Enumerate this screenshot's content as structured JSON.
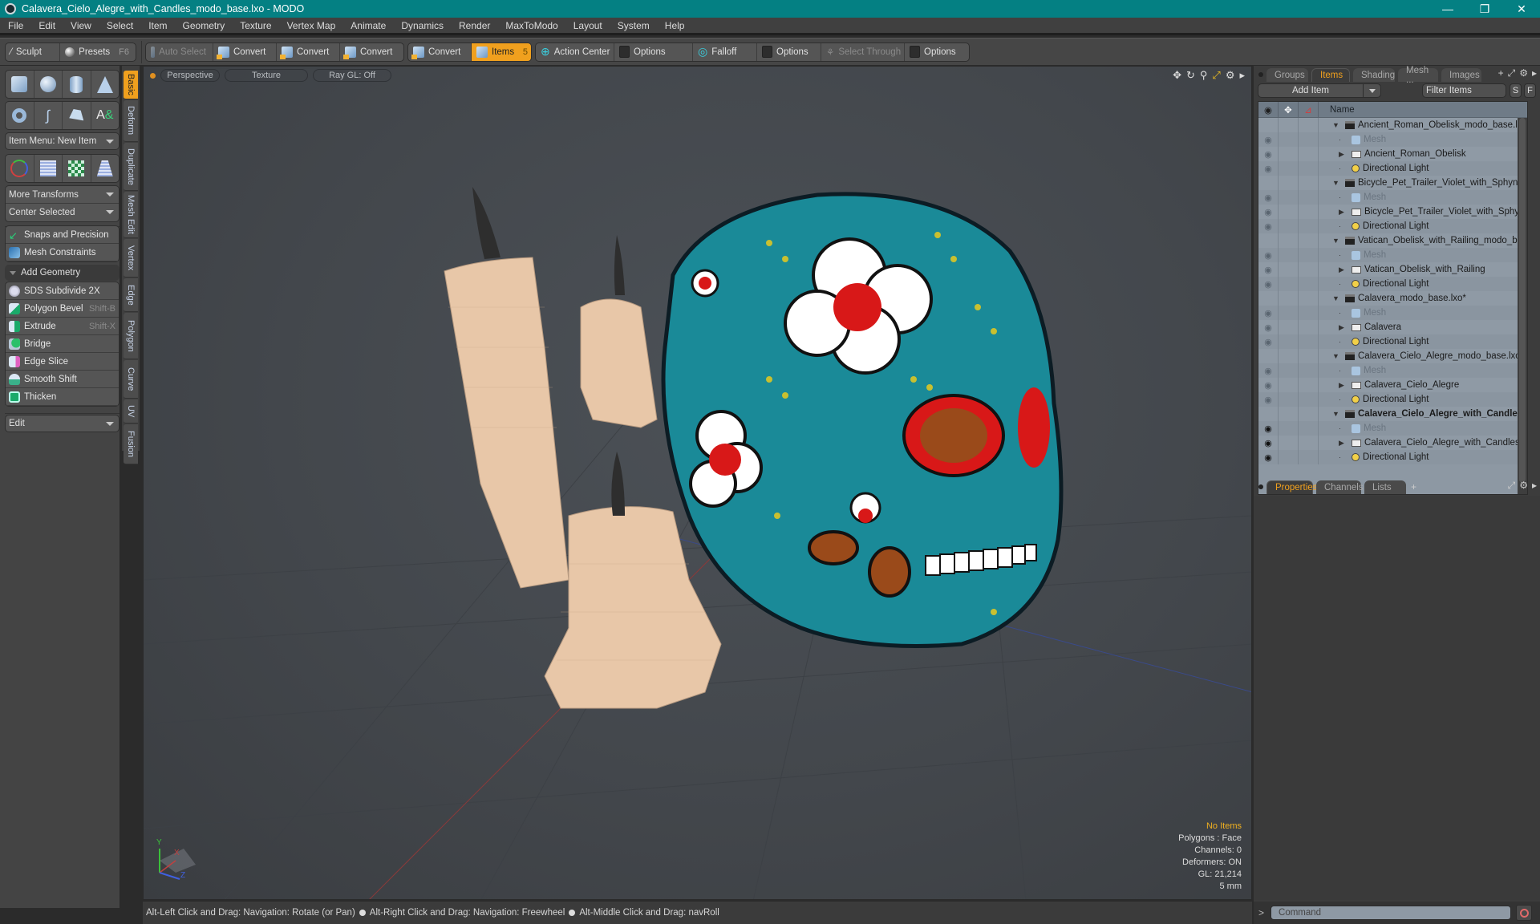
{
  "window": {
    "title": "Calavera_Cielo_Alegre_with_Candles_modo_base.lxo - MODO",
    "controls": [
      "minimize",
      "restore",
      "close"
    ]
  },
  "menu": [
    "File",
    "Edit",
    "View",
    "Select",
    "Item",
    "Geometry",
    "Texture",
    "Vertex Map",
    "Animate",
    "Dynamics",
    "Render",
    "MaxToModo",
    "Layout",
    "System",
    "Help"
  ],
  "toolbar": {
    "sculpt": "Sculpt",
    "presets": "Presets",
    "presets_key": "F6",
    "auto_select": "Auto Select",
    "convert1": "Convert",
    "convert2": "Convert",
    "convert3": "Convert",
    "convert4": "Convert",
    "items": "Items",
    "items_key": "5",
    "action_center": "Action Center",
    "options1": "Options",
    "falloff": "Falloff",
    "options2": "Options",
    "select_through": "Select Through",
    "options3": "Options"
  },
  "left_panel": {
    "item_menu": "Item Menu: New Item",
    "more_transforms": "More Transforms",
    "center_selected": "Center Selected",
    "snaps": "Snaps and Precision",
    "mesh_constraints": "Mesh Constraints",
    "add_geometry": "Add Geometry",
    "tools": [
      {
        "label": "SDS Subdivide 2X",
        "shortcut": ""
      },
      {
        "label": "Polygon Bevel",
        "shortcut": "Shift-B"
      },
      {
        "label": "Extrude",
        "shortcut": "Shift-X"
      },
      {
        "label": "Bridge",
        "shortcut": ""
      },
      {
        "label": "Edge Slice",
        "shortcut": ""
      },
      {
        "label": "Smooth Shift",
        "shortcut": ""
      },
      {
        "label": "Thicken",
        "shortcut": ""
      }
    ],
    "edit_dropdown": "Edit",
    "vertical_tabs": [
      "Basic",
      "Deform",
      "Duplicate",
      "Mesh Edit",
      "Vertex",
      "Edge",
      "Polygon",
      "Curve",
      "UV",
      "Fusion"
    ],
    "active_tab": "Basic"
  },
  "viewport": {
    "view": "Perspective",
    "shading": "Texture",
    "raygl": "Ray GL: Off",
    "hud": {
      "selection": "No Items",
      "polygons": "Polygons : Face",
      "channels": "Channels: 0",
      "deformers": "Deformers: ON",
      "gl": "GL: 21,214",
      "unit": "5 mm"
    },
    "axes": {
      "x": "X",
      "y": "Y",
      "z": "Z"
    }
  },
  "status": {
    "hint1": "Alt-Left Click and Drag: Navigation: Rotate (or Pan)",
    "hint2": "Alt-Right Click and Drag: Navigation: Freewheel",
    "hint3": "Alt-Middle Click and Drag: navRoll"
  },
  "right_panel": {
    "tabs": [
      "Groups",
      "Items",
      "Shading",
      "Mesh ...",
      "Images"
    ],
    "active_tab": "Items",
    "add_item": "Add Item",
    "filter_placeholder": "Filter Items",
    "s_btn": "S",
    "f_btn": "F",
    "name_col": "Name",
    "tree": [
      {
        "label": "Ancient_Roman_Obelisk_modo_base.lxo",
        "type": "scene",
        "level": 0
      },
      {
        "label": "Mesh",
        "type": "mesh",
        "level": 1
      },
      {
        "label": "Ancient_Roman_Obelisk",
        "type": "group",
        "level": 1
      },
      {
        "label": "Directional Light",
        "type": "light",
        "level": 1
      },
      {
        "label": "Bicycle_Pet_Trailer_Violet_with_Sphynx_m ...",
        "type": "scene",
        "level": 0
      },
      {
        "label": "Mesh",
        "type": "mesh",
        "level": 1
      },
      {
        "label": "Bicycle_Pet_Trailer_Violet_with_Sphynx",
        "type": "group",
        "level": 1
      },
      {
        "label": "Directional Light",
        "type": "light",
        "level": 1
      },
      {
        "label": "Vatican_Obelisk_with_Railing_modo_base.lxo",
        "type": "scene",
        "level": 0
      },
      {
        "label": "Mesh",
        "type": "mesh",
        "level": 1
      },
      {
        "label": "Vatican_Obelisk_with_Railing",
        "type": "group",
        "level": 1
      },
      {
        "label": "Directional Light",
        "type": "light",
        "level": 1
      },
      {
        "label": "Calavera_modo_base.lxo*",
        "type": "scene",
        "level": 0
      },
      {
        "label": "Mesh",
        "type": "mesh",
        "level": 1
      },
      {
        "label": "Calavera",
        "type": "group",
        "level": 1
      },
      {
        "label": "Directional Light",
        "type": "light",
        "level": 1
      },
      {
        "label": "Calavera_Cielo_Alegre_modo_base.lxo*",
        "type": "scene",
        "level": 0
      },
      {
        "label": "Mesh",
        "type": "mesh",
        "level": 1
      },
      {
        "label": "Calavera_Cielo_Alegre",
        "type": "group",
        "level": 1
      },
      {
        "label": "Directional Light",
        "type": "light",
        "level": 1
      },
      {
        "label": "Calavera_Cielo_Alegre_with_Candle ...",
        "type": "scene",
        "level": 0,
        "active": true
      },
      {
        "label": "Mesh",
        "type": "mesh",
        "level": 1,
        "active": true
      },
      {
        "label": "Calavera_Cielo_Alegre_with_Candles",
        "type": "group",
        "level": 1,
        "active": true
      },
      {
        "label": "Directional Light",
        "type": "light",
        "level": 1,
        "active": true
      }
    ],
    "bottom_tabs": [
      "Properties",
      "Channels",
      "Lists"
    ],
    "bottom_active": "Properties",
    "command_placeholder": "Command"
  },
  "colors": {
    "titlebar": "#048083",
    "accent": "#f0a01e",
    "skull_teal": "#1a8a98",
    "skull_red": "#d81818",
    "candle": "#e8c7a8"
  }
}
